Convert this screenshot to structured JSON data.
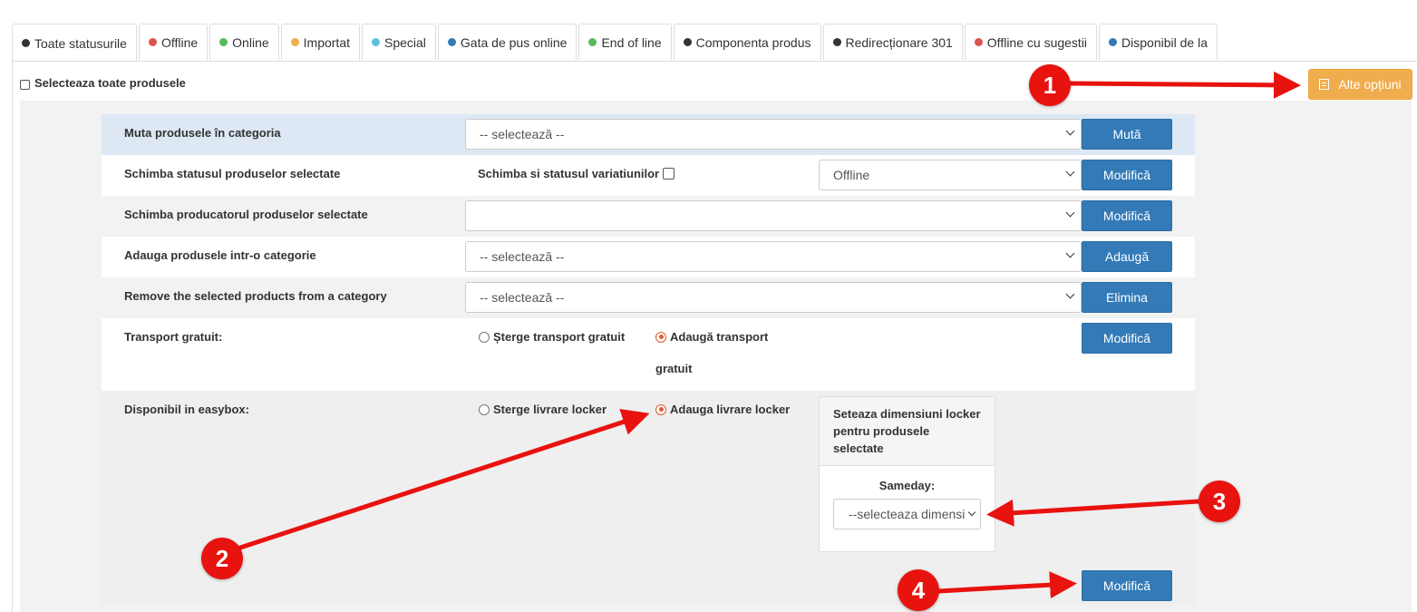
{
  "tabs": [
    {
      "label": "Toate statusurile",
      "color": "#333333"
    },
    {
      "label": "Offline",
      "color": "#d9534f"
    },
    {
      "label": "Online",
      "color": "#5cb85c"
    },
    {
      "label": "Importat",
      "color": "#f0ad4e"
    },
    {
      "label": "Special",
      "color": "#5bc0de"
    },
    {
      "label": "Gata de pus online",
      "color": "#337ab7"
    },
    {
      "label": "End of line",
      "color": "#5cb85c"
    },
    {
      "label": "Componenta produs",
      "color": "#333333"
    },
    {
      "label": "Redirecționare 301",
      "color": "#333333"
    },
    {
      "label": "Offline cu sugestii",
      "color": "#d9534f"
    },
    {
      "label": "Disponibil de la",
      "color": "#337ab7"
    }
  ],
  "select_all_label": "Selecteaza toate produsele",
  "alte_optiuni_label": "Alte opțiuni",
  "rows": {
    "move": {
      "label": "Muta produsele în categoria",
      "select_value": "-- selectează --",
      "button": "Mută"
    },
    "status": {
      "label": "Schimba statusul produselor selectate",
      "variations_label": "Schimba si statusul variatiunilor",
      "select_value": "Offline",
      "button": "Modifică"
    },
    "producer": {
      "label": "Schimba producatorul produselor selectate",
      "select_value": "",
      "button": "Modifică"
    },
    "add_cat": {
      "label": "Adauga produsele intr-o categorie",
      "select_value": "-- selectează --",
      "button": "Adaugă"
    },
    "remove_cat": {
      "label": "Remove the selected products from a category",
      "select_value": "-- selectează --",
      "button": "Elimina"
    },
    "transport": {
      "label": "Transport gratuit:",
      "option_remove": "Șterge transport gratuit",
      "option_add": "Adaugă transport",
      "option_add_cont": "gratuit",
      "button": "Modifică"
    },
    "easybox": {
      "label": "Disponibil in easybox:",
      "option_remove": "Sterge livrare locker",
      "option_add": "Adauga livrare locker",
      "locker_title": "Seteaza dimensiuni locker pentru produsele selectate",
      "sameday_label": "Sameday:",
      "locker_select": "--selecteaza dimensi",
      "button": "Modifică"
    }
  },
  "markers": [
    "1",
    "2",
    "3",
    "4"
  ]
}
